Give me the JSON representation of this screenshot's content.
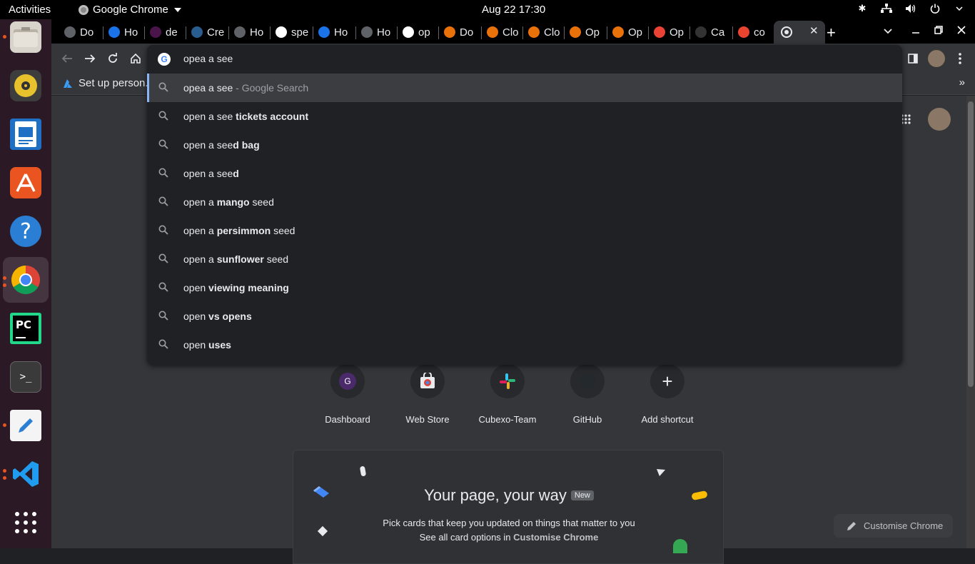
{
  "system": {
    "activities_label": "Activities",
    "app_name": "Google Chrome",
    "clock": "Aug 22  17:30"
  },
  "tabs": [
    {
      "title": "Do",
      "icon": "download-icon",
      "color": "#5f6368"
    },
    {
      "title": "Ho",
      "icon": "headset-icon",
      "color": "#1a73e8"
    },
    {
      "title": "de",
      "icon": "slack-icon",
      "color": "#4a154b"
    },
    {
      "title": "Cre",
      "icon": "tds-icon",
      "color": "#2a5d8f"
    },
    {
      "title": "Ho",
      "icon": "globe-icon",
      "color": "#5f6368"
    },
    {
      "title": "spe",
      "icon": "google-icon",
      "color": "#ffffff"
    },
    {
      "title": "Ho",
      "icon": "headset-icon",
      "color": "#1a73e8"
    },
    {
      "title": "Ho",
      "icon": "globe-icon",
      "color": "#5f6368"
    },
    {
      "title": "op",
      "icon": "google-icon",
      "color": "#ffffff"
    },
    {
      "title": "Do",
      "icon": "headphones-icon",
      "color": "#e8710a"
    },
    {
      "title": "Clo",
      "icon": "headphones-icon",
      "color": "#e8710a"
    },
    {
      "title": "Clo",
      "icon": "headphones-icon",
      "color": "#e8710a"
    },
    {
      "title": "Op",
      "icon": "headphones-icon",
      "color": "#e8710a"
    },
    {
      "title": "Op",
      "icon": "headphones-icon",
      "color": "#e8710a"
    },
    {
      "title": "Op",
      "icon": "gmail-icon",
      "color": "#ea4335"
    },
    {
      "title": "Ca",
      "icon": "github-icon",
      "color": "#333333"
    },
    {
      "title": "co",
      "icon": "ask-icon",
      "color": "#e8442f"
    }
  ],
  "bookmarks": {
    "item_label": "Set up person..."
  },
  "omnibox": {
    "input_value": "opea a see",
    "suggestions": [
      {
        "typed": "opea a see",
        "rest": "",
        "suffix": " - Google Search"
      },
      {
        "typed": "open a see",
        "rest": " tickets account",
        "suffix": ""
      },
      {
        "typed": "open a see",
        "rest": "d bag",
        "suffix": ""
      },
      {
        "typed": "open a see",
        "rest": "d",
        "suffix": ""
      },
      {
        "typed": "open a ",
        "rest": "mango",
        "suffix": " seed"
      },
      {
        "typed": "open a ",
        "rest": "persimmon",
        "suffix": " seed"
      },
      {
        "typed": "open a ",
        "rest": "sunflower",
        "suffix": " seed"
      },
      {
        "typed": "open ",
        "rest": "viewing meaning",
        "suffix": ""
      },
      {
        "typed": "open ",
        "rest": "vs opens",
        "suffix": ""
      },
      {
        "typed": "open ",
        "rest": "uses",
        "suffix": ""
      }
    ]
  },
  "shortcuts": [
    {
      "label": "Dashboard",
      "icon": "g-letter-icon",
      "letter": "G"
    },
    {
      "label": "Web Store",
      "icon": "web-store-icon",
      "letter": ""
    },
    {
      "label": "Cubexo-Team",
      "icon": "slack-icon",
      "letter": ""
    },
    {
      "label": "GitHub",
      "icon": "github-icon",
      "letter": ""
    },
    {
      "label": "Add shortcut",
      "icon": "plus-icon",
      "letter": "+"
    }
  ],
  "card": {
    "title": "Your page, your way",
    "badge": "New",
    "description_line1": "Pick cards that keep you updated on things that matter to you",
    "description_line2_prefix": "See all card options in ",
    "description_line2_link": "Customise Chrome"
  },
  "customise_button": "Customise Chrome",
  "colors": {
    "accent_blue": "#8ab4f8",
    "dock_bg": "#2b1a26",
    "ubuntu_orange": "#e95420"
  }
}
